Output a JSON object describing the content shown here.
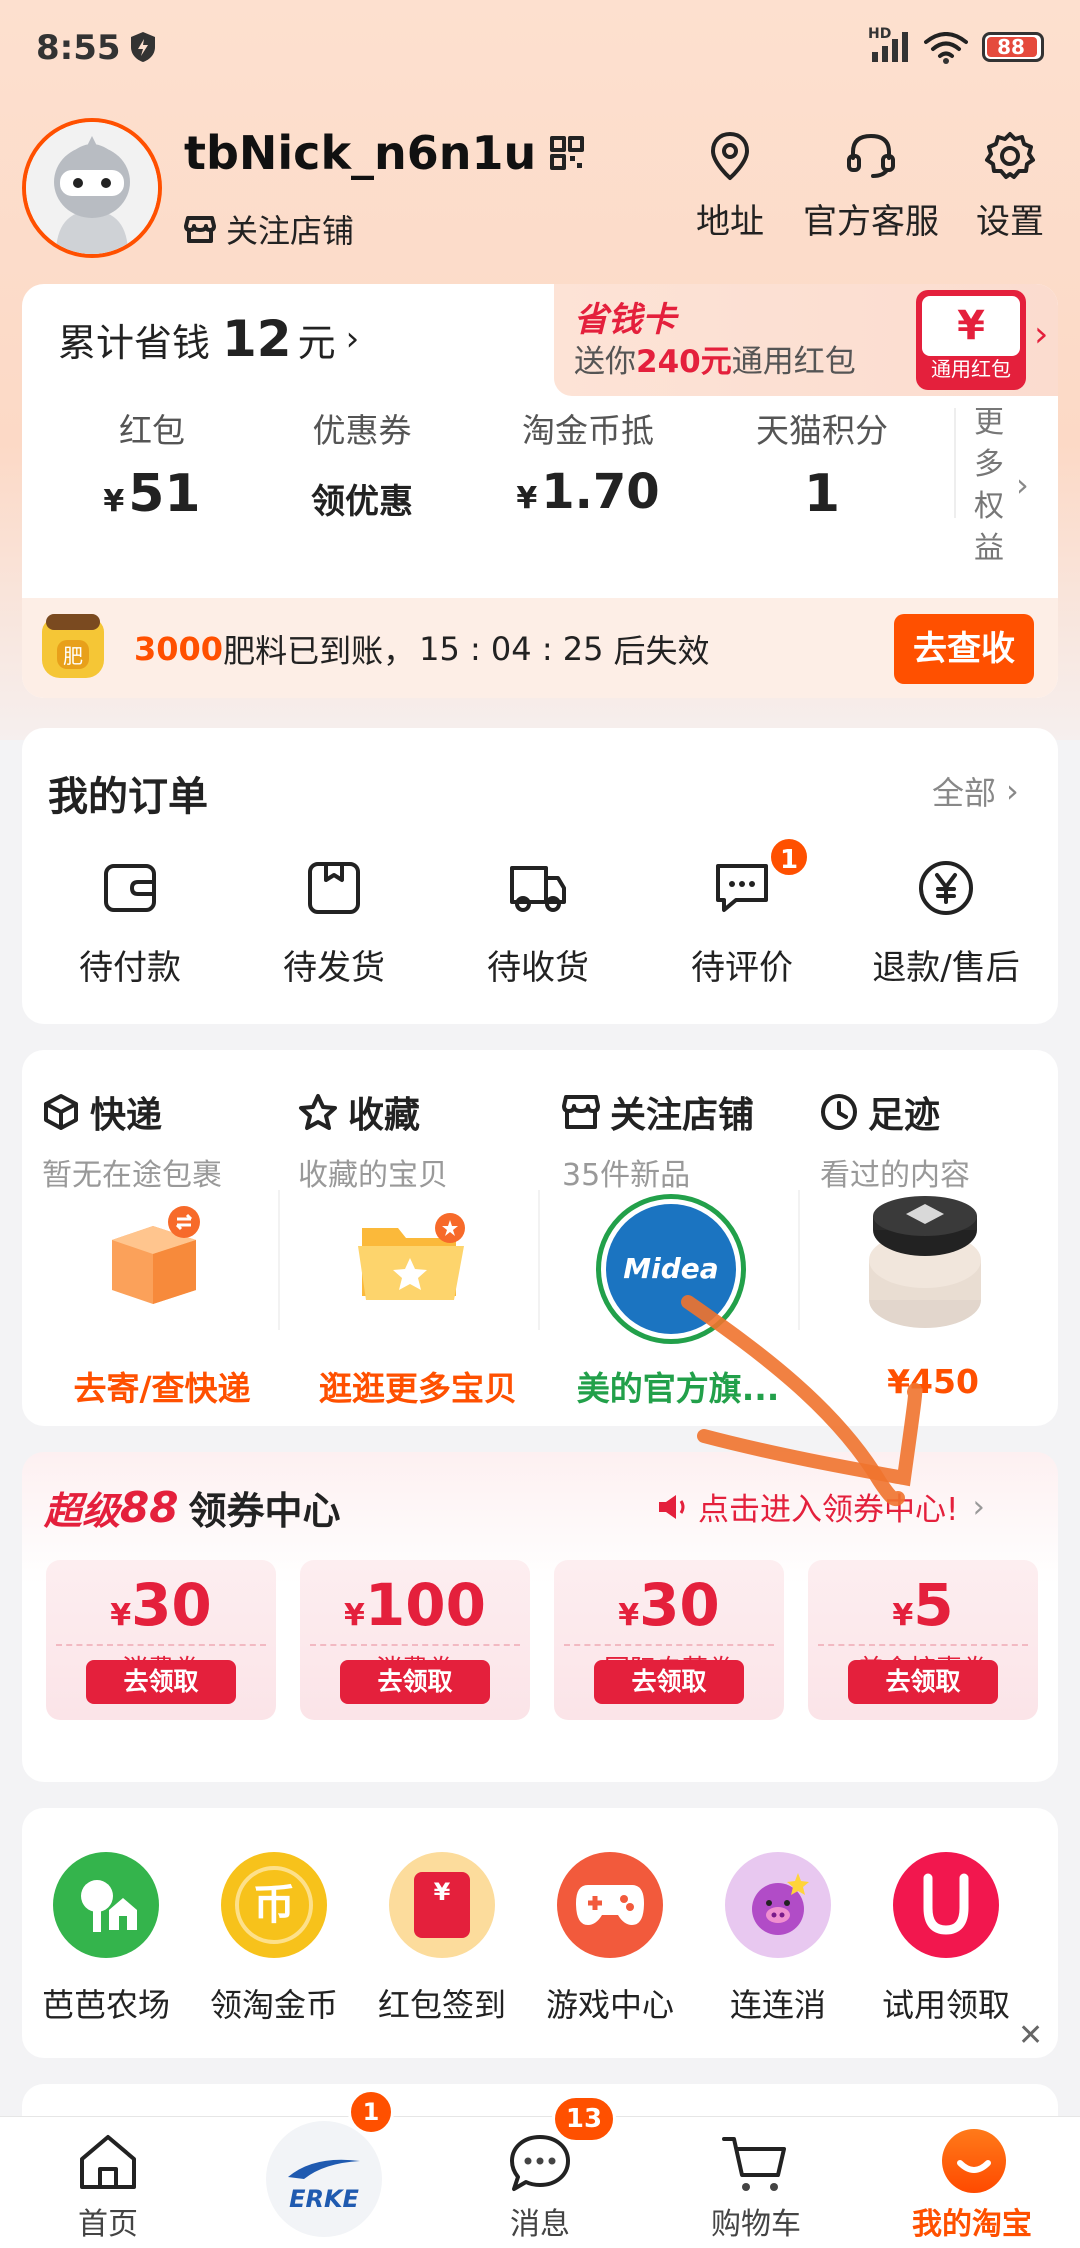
{
  "status_bar": {
    "time": "8:55",
    "battery": "88",
    "network": "HD"
  },
  "profile": {
    "username": "tbNick_n6n1u",
    "follow_shops": "关注店铺",
    "actions": [
      {
        "icon": "location-pin-icon",
        "label": "地址"
      },
      {
        "icon": "headset-icon",
        "label": "官方客服"
      },
      {
        "icon": "gear-icon",
        "label": "设置"
      }
    ]
  },
  "savings": {
    "prefix": "累计省钱",
    "amount": "12",
    "unit": "元",
    "card_title": "省钱卡",
    "card_text_prefix": "送你",
    "card_amount": "240元",
    "card_text_suffix": "通用红包",
    "card_badge_symbol": "¥",
    "card_badge_label": "通用红包",
    "assets": [
      {
        "label": "红包",
        "value": "51",
        "currency": "¥"
      },
      {
        "label": "优惠券",
        "value": "领优惠",
        "currency": ""
      },
      {
        "label": "淘金币抵",
        "value": "1.70",
        "currency": "¥"
      },
      {
        "label": "天猫积分",
        "value": "1",
        "currency": ""
      }
    ],
    "more_rights": "更多权益",
    "fertilizer_amount": "3000",
    "fertilizer_text": "肥料已到账，",
    "countdown": "15 : 04 : 25",
    "countdown_suffix": "后失效",
    "fertilizer_button": "去查收",
    "fertilizer_bag_label": "肥"
  },
  "orders": {
    "title": "我的订单",
    "all_label": "全部",
    "items": [
      {
        "icon": "wallet-icon",
        "label": "待付款"
      },
      {
        "icon": "package-box-icon",
        "label": "待发货"
      },
      {
        "icon": "delivery-truck-icon",
        "label": "待收货"
      },
      {
        "icon": "comment-bubble-icon",
        "label": "待评价",
        "badge": "1"
      },
      {
        "icon": "yen-circle-icon",
        "label": "退款/售后"
      }
    ]
  },
  "shortcuts": [
    {
      "title": "快递",
      "subtitle": "暂无在途包裹",
      "action": "去寄/查快递"
    },
    {
      "title": "收藏",
      "subtitle": "收藏的宝贝",
      "action": "逛逛更多宝贝"
    },
    {
      "title": "关注店铺",
      "subtitle": "35件新品",
      "action": "美的官方旗...",
      "logo": "Midea"
    },
    {
      "title": "足迹",
      "subtitle": "看过的内容",
      "action": "¥450"
    }
  ],
  "coupon_center": {
    "brand_prefix": "超级",
    "brand_number": "88",
    "title": "领券中心",
    "link": "点击进入领券中心!",
    "coupons": [
      {
        "currency": "¥",
        "amount": "30",
        "name": "消费券",
        "button": "去领取"
      },
      {
        "currency": "¥",
        "amount": "100",
        "name": "消费券",
        "button": "去领取"
      },
      {
        "currency": "¥",
        "amount": "30",
        "name": "国际自营券",
        "button": "去领取"
      },
      {
        "currency": "¥",
        "amount": "5",
        "name": "美食惊喜券",
        "button": "去领取"
      }
    ]
  },
  "tools": [
    {
      "icon": "farm-tree-icon",
      "label": "芭芭农场",
      "color": "#34b44c"
    },
    {
      "icon": "gold-coin-icon",
      "label": "领淘金币",
      "color": "#f7c21b",
      "glyph": "币"
    },
    {
      "icon": "red-envelope-icon",
      "label": "红包签到",
      "color": "#fcdc9c",
      "glyph": "¥"
    },
    {
      "icon": "gamepad-icon",
      "label": "游戏中心",
      "color": "#f25a3c"
    },
    {
      "icon": "pig-game-icon",
      "label": "连连消",
      "color": "#e8c8f0"
    },
    {
      "icon": "u-magnet-icon",
      "label": "试用领取",
      "color": "#f2174e"
    }
  ],
  "tab_bar": {
    "tabs": [
      {
        "icon": "home-icon",
        "label": "首页"
      },
      {
        "icon": "erke-brand-icon",
        "label": "ERKE",
        "badge": "1"
      },
      {
        "icon": "message-icon",
        "label": "消息",
        "badge": "13"
      },
      {
        "icon": "cart-icon",
        "label": "购物车"
      },
      {
        "icon": "my-taobao-icon",
        "label": "我的淘宝"
      }
    ]
  },
  "colors": {
    "accent": "#ff5000",
    "coupon_red": "#e4203c",
    "midea_green": "#22a04a",
    "annotation_orange": "#f0732e"
  }
}
